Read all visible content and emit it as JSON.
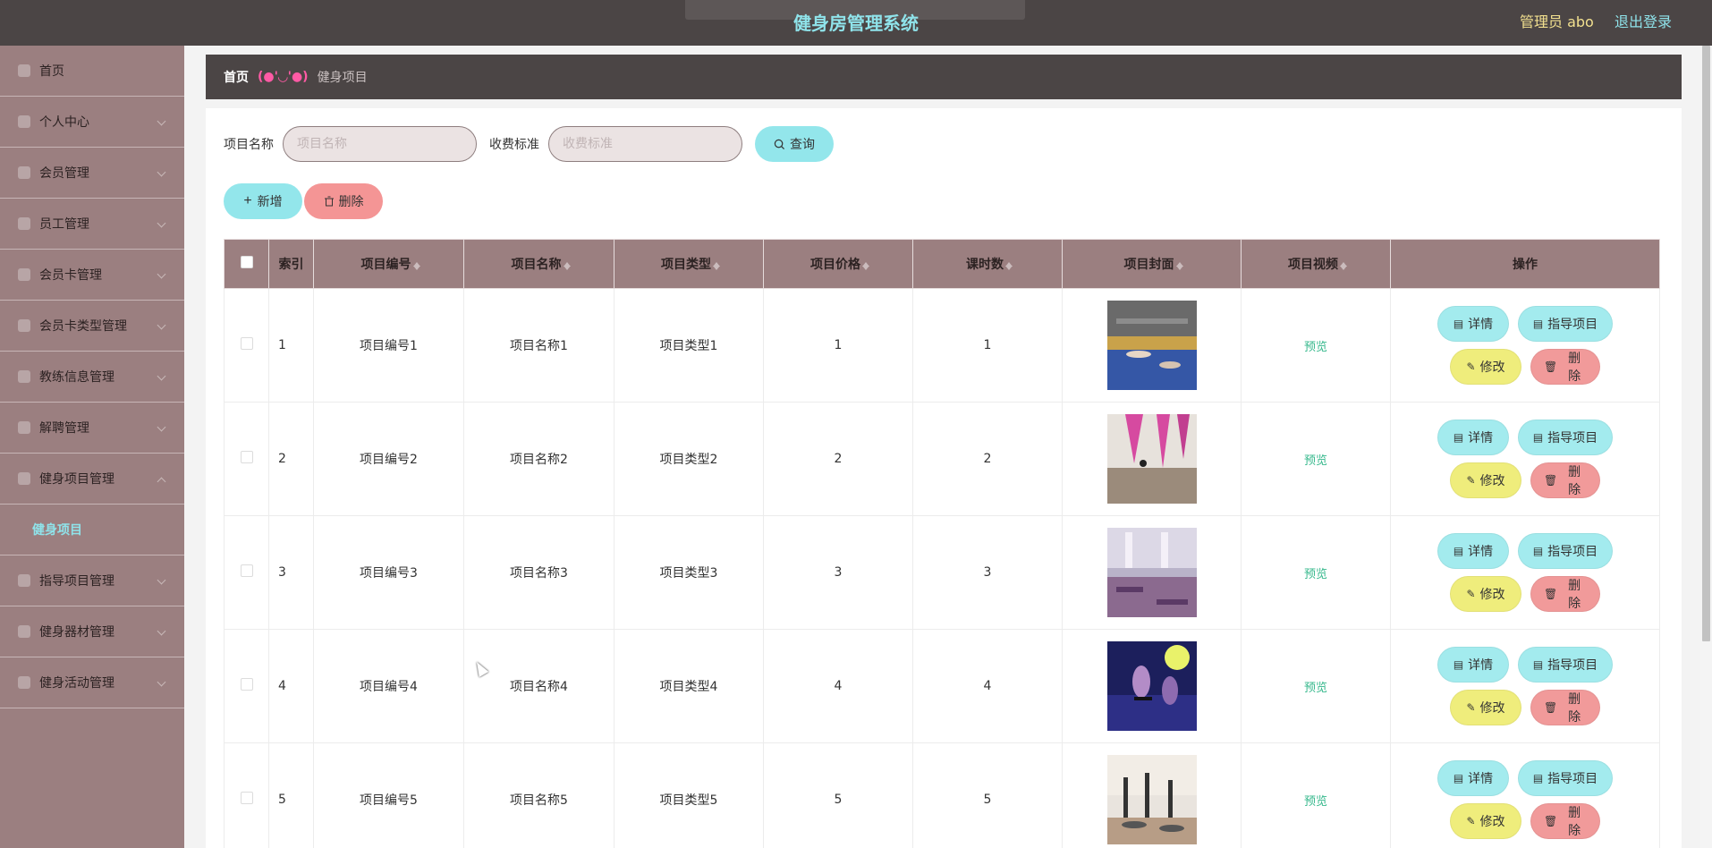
{
  "app": {
    "title": "健身房管理系统",
    "admin_label": "管理员 abo",
    "logout_label": "退出登录"
  },
  "sidebar": {
    "items": [
      {
        "label": "首页",
        "icon": "home-icon",
        "has_arrow": false
      },
      {
        "label": "个人中心",
        "icon": "user-icon",
        "has_arrow": true
      },
      {
        "label": "会员管理",
        "icon": "flag-icon",
        "has_arrow": true
      },
      {
        "label": "员工管理",
        "icon": "chat-icon",
        "has_arrow": true
      },
      {
        "label": "会员卡管理",
        "icon": "chart-icon",
        "has_arrow": true
      },
      {
        "label": "会员卡类型管理",
        "icon": "list-icon",
        "has_arrow": true
      },
      {
        "label": "教练信息管理",
        "icon": "clock-icon",
        "has_arrow": true
      },
      {
        "label": "解聘管理",
        "icon": "pin-icon",
        "has_arrow": true
      },
      {
        "label": "健身项目管理",
        "icon": "doc-icon",
        "has_arrow": true
      },
      {
        "label": "指导项目管理",
        "icon": "doc-icon",
        "has_arrow": true
      },
      {
        "label": "健身器材管理",
        "icon": "user-icon",
        "has_arrow": true
      },
      {
        "label": "健身活动管理",
        "icon": "doc-icon",
        "has_arrow": true
      }
    ],
    "active_sub": "健身项目"
  },
  "breadcrumb": {
    "home": "首页",
    "kaomoji": "(●'◡'●)",
    "current": "健身项目"
  },
  "search": {
    "name_label": "项目名称",
    "name_placeholder": "项目名称",
    "fee_label": "收费标准",
    "fee_placeholder": "收费标准",
    "query_label": "查询"
  },
  "actions": {
    "add_label": "新增",
    "delete_label": "删除"
  },
  "table": {
    "headers": {
      "index": "索引",
      "code": "项目编号",
      "name": "项目名称",
      "type": "项目类型",
      "price": "项目价格",
      "hours": "课时数",
      "cover": "项目封面",
      "video": "项目视频",
      "ops": "操作"
    },
    "rows": [
      {
        "index": "1",
        "code": "项目编号1",
        "name": "项目名称1",
        "type": "项目类型1",
        "price": "1",
        "hours": "1",
        "video": "预览"
      },
      {
        "index": "2",
        "code": "项目编号2",
        "name": "项目名称2",
        "type": "项目类型2",
        "price": "2",
        "hours": "2",
        "video": "预览"
      },
      {
        "index": "3",
        "code": "项目编号3",
        "name": "项目名称3",
        "type": "项目类型3",
        "price": "3",
        "hours": "3",
        "video": "预览"
      },
      {
        "index": "4",
        "code": "项目编号4",
        "name": "项目名称4",
        "type": "项目类型4",
        "price": "4",
        "hours": "4",
        "video": "预览"
      },
      {
        "index": "5",
        "code": "项目编号5",
        "name": "项目名称5",
        "type": "项目类型5",
        "price": "5",
        "hours": "5",
        "video": "预览"
      }
    ],
    "op_labels": {
      "detail": "详情",
      "guide": "指导项目",
      "edit": "修改",
      "delete": "删除"
    }
  },
  "colors": {
    "header_bg": "#4b4545",
    "sidebar_bg": "#9b7f80",
    "accent_cyan": "#93e6eb",
    "danger": "#f49595",
    "warn": "#efed7c"
  }
}
